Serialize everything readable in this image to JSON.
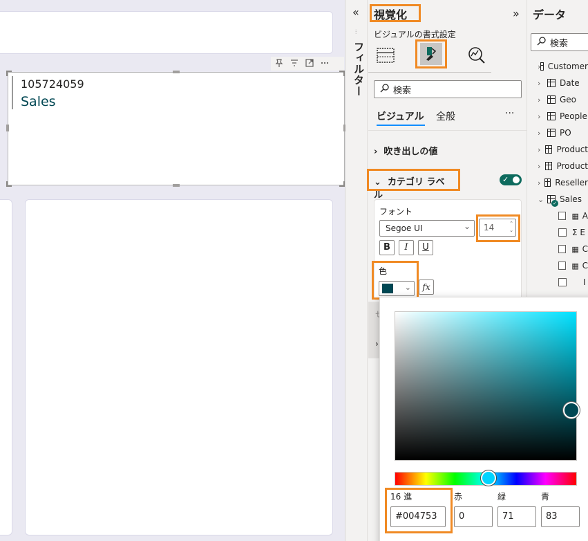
{
  "canvas": {
    "kpi_card": {
      "value": "105724059",
      "label": "Sales"
    },
    "visual_header_icons": [
      "pin-icon",
      "filter-icon",
      "focus-mode-icon",
      "more-options-icon"
    ]
  },
  "filters": {
    "title": "フィルター",
    "toggle": "«"
  },
  "viz_pane": {
    "title": "視覚化",
    "collapse": "»",
    "subtitle": "ビジュアルの書式設定",
    "search_placeholder": "検索",
    "tabs": {
      "visual": "ビジュアル",
      "general": "全般",
      "more": "···"
    },
    "sections": {
      "callout_value": "吹き出しの値",
      "category_label": "カテゴリ ラベル"
    },
    "category_label_on": true,
    "font": {
      "label": "フォント",
      "family": "Segoe UI",
      "size": "14"
    },
    "format_buttons": {
      "bold": "B",
      "italic": "I",
      "underline": "U"
    },
    "color": {
      "label": "色",
      "value": "#004753"
    },
    "fx": "fx"
  },
  "data_pane": {
    "title": "データ",
    "search_placeholder": "検索",
    "tables": [
      "Customer",
      "Date",
      "Geo",
      "People",
      "PO",
      "Product",
      "Product",
      "Reseller",
      "Sales"
    ],
    "sales_fields": [
      "A",
      "Σ E",
      "C",
      "C",
      "I"
    ]
  },
  "color_picker": {
    "hex_label": "16 進",
    "red_label": "赤",
    "green_label": "緑",
    "blue_label": "青",
    "hex": "#004753",
    "red": "0",
    "green": "71",
    "blue": "83"
  }
}
